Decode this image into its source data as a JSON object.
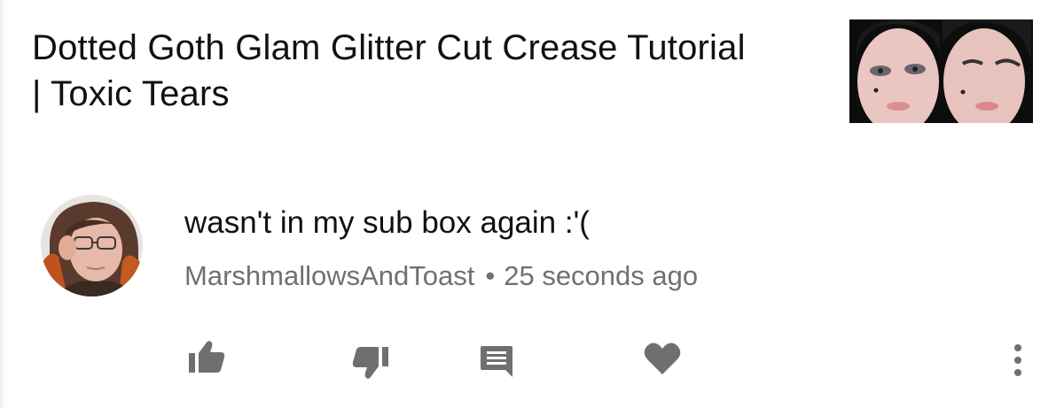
{
  "video": {
    "title": "Dotted Goth Glam Glitter Cut Crease Tutorial | Toxic Tears",
    "thumbnail_icon": "video-thumbnail"
  },
  "comment": {
    "avatar_icon": "user-avatar",
    "text": "wasn't in my sub box again :'(",
    "author": "MarshmallowsAndToast",
    "separator": "•",
    "time": "25 seconds ago"
  },
  "actions": {
    "icons": [
      "thumbs-up-icon",
      "thumbs-down-icon",
      "reply-icon",
      "heart-icon",
      "more-vert-icon"
    ],
    "icon_color": "#6f6f6f"
  }
}
